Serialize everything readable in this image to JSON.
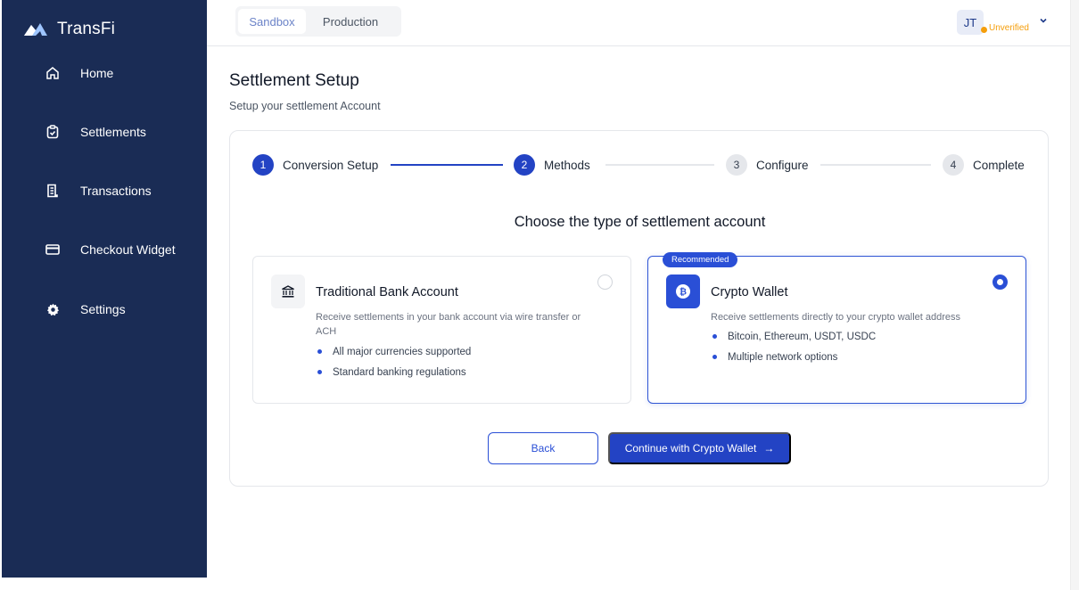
{
  "brand": {
    "name": "TransFi"
  },
  "sidebar": {
    "items": [
      {
        "label": "Home",
        "icon": "home-icon"
      },
      {
        "label": "Settlements",
        "icon": "clipboard-check-icon"
      },
      {
        "label": "Transactions",
        "icon": "receipt-icon"
      },
      {
        "label": "Checkout Widget",
        "icon": "card-icon"
      },
      {
        "label": "Settings",
        "icon": "gear-icon"
      }
    ]
  },
  "topbar": {
    "env": {
      "sandbox": "Sandbox",
      "production": "Production",
      "selected": "Sandbox"
    },
    "user": {
      "initials": "JT",
      "status": "Unverified"
    }
  },
  "page": {
    "title": "Settlement Setup",
    "subtitle": "Setup your settlement Account"
  },
  "stepper": {
    "steps": [
      {
        "number": "1",
        "label": "Conversion Setup",
        "state": "done"
      },
      {
        "number": "2",
        "label": "Methods",
        "state": "active"
      },
      {
        "number": "3",
        "label": "Configure",
        "state": "upcoming"
      },
      {
        "number": "4",
        "label": "Complete",
        "state": "upcoming"
      }
    ]
  },
  "choose_title": "Choose the type of settlement account",
  "options": {
    "bank": {
      "title": "Traditional Bank Account",
      "description": "Receive settlements in your bank account via wire transfer or ACH",
      "bullets": [
        "All major currencies supported",
        "Standard banking regulations"
      ],
      "selected": false,
      "icon": "bank-icon"
    },
    "crypto": {
      "badge": "Recommended",
      "title": "Crypto Wallet",
      "description": "Receive settlements directly to your crypto wallet address",
      "bullets": [
        "Bitcoin, Ethereum, USDT, USDC",
        "Multiple network options"
      ],
      "selected": true,
      "icon": "bitcoin-icon"
    }
  },
  "actions": {
    "back": "Back",
    "continue": "Continue with Crypto Wallet",
    "continue_arrow": "→"
  },
  "colors": {
    "sidebar_bg": "#1a2c55",
    "accent": "#2343c4",
    "warning": "#f59e0b"
  }
}
